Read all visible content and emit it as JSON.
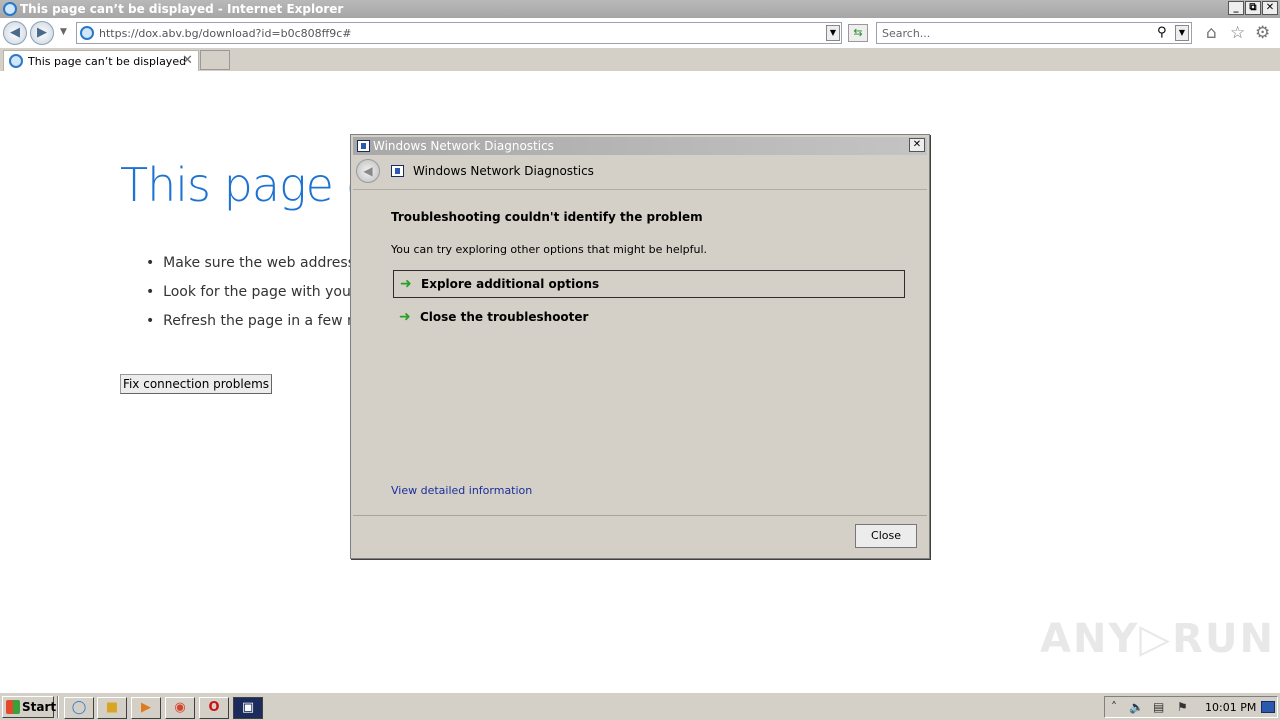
{
  "window": {
    "title": "This page can’t be displayed - Internet Explorer",
    "controls": {
      "minimize": "_",
      "restore": "⧉",
      "close": "✕"
    }
  },
  "toolbar": {
    "url": "https://dox.abv.bg/download?id=b0c808ff9c#",
    "search_placeholder": "Search...",
    "icons": [
      "back-icon",
      "forward-icon",
      "refresh-icon",
      "search-icon",
      "home-icon",
      "favorites-icon",
      "gear-icon"
    ]
  },
  "tabs": [
    {
      "label": "This page can’t be displayed",
      "close": "✕"
    }
  ],
  "page": {
    "title": "This page c",
    "bullets": [
      "Make sure the web address h",
      "Look for the page with your",
      "Refresh the page in a few mi"
    ],
    "fix_button": "Fix connection problems"
  },
  "dialog": {
    "title": "Windows Network Diagnostics",
    "header": "Windows Network Diagnostics",
    "heading": "Troubleshooting couldn't identify the problem",
    "text": "You can try exploring other options that might be helpful.",
    "options": [
      {
        "label": "Explore additional options"
      },
      {
        "label": "Close the troubleshooter"
      }
    ],
    "detail_link": "View detailed information",
    "close_button": "Close"
  },
  "taskbar": {
    "start_label": "Start",
    "clock": "10:01 PM"
  },
  "watermark": "ANY▷RUN"
}
